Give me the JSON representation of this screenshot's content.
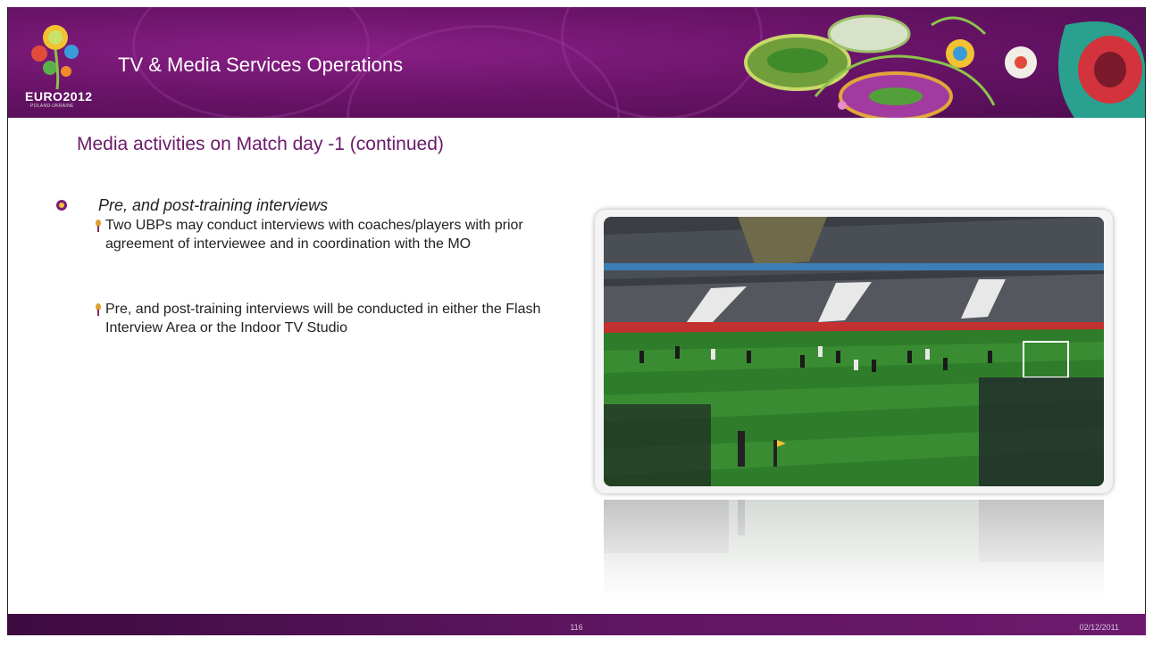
{
  "header": {
    "title": "TV & Media Services Operations",
    "logo_text": "EURO2012",
    "logo_subtext": "POLAND-UKRAINE"
  },
  "slide": {
    "subtitle": "Media activities on Match day -1 (continued)",
    "bullet": "Pre, and post-training interviews",
    "sub_bullets": [
      "Two UBPs may conduct interviews with coaches/players with prior agreement of interviewee and in coordination with the MO",
      "Pre, and post-training interviews will be conducted in either the Flash Interview Area or the Indoor TV Studio"
    ]
  },
  "footer": {
    "page_number": "116",
    "date": "02/12/2011"
  },
  "colors": {
    "brand_purple": "#6b146a",
    "subtitle_purple": "#6a1a6a",
    "pitch_green": "#2f7d2a"
  }
}
